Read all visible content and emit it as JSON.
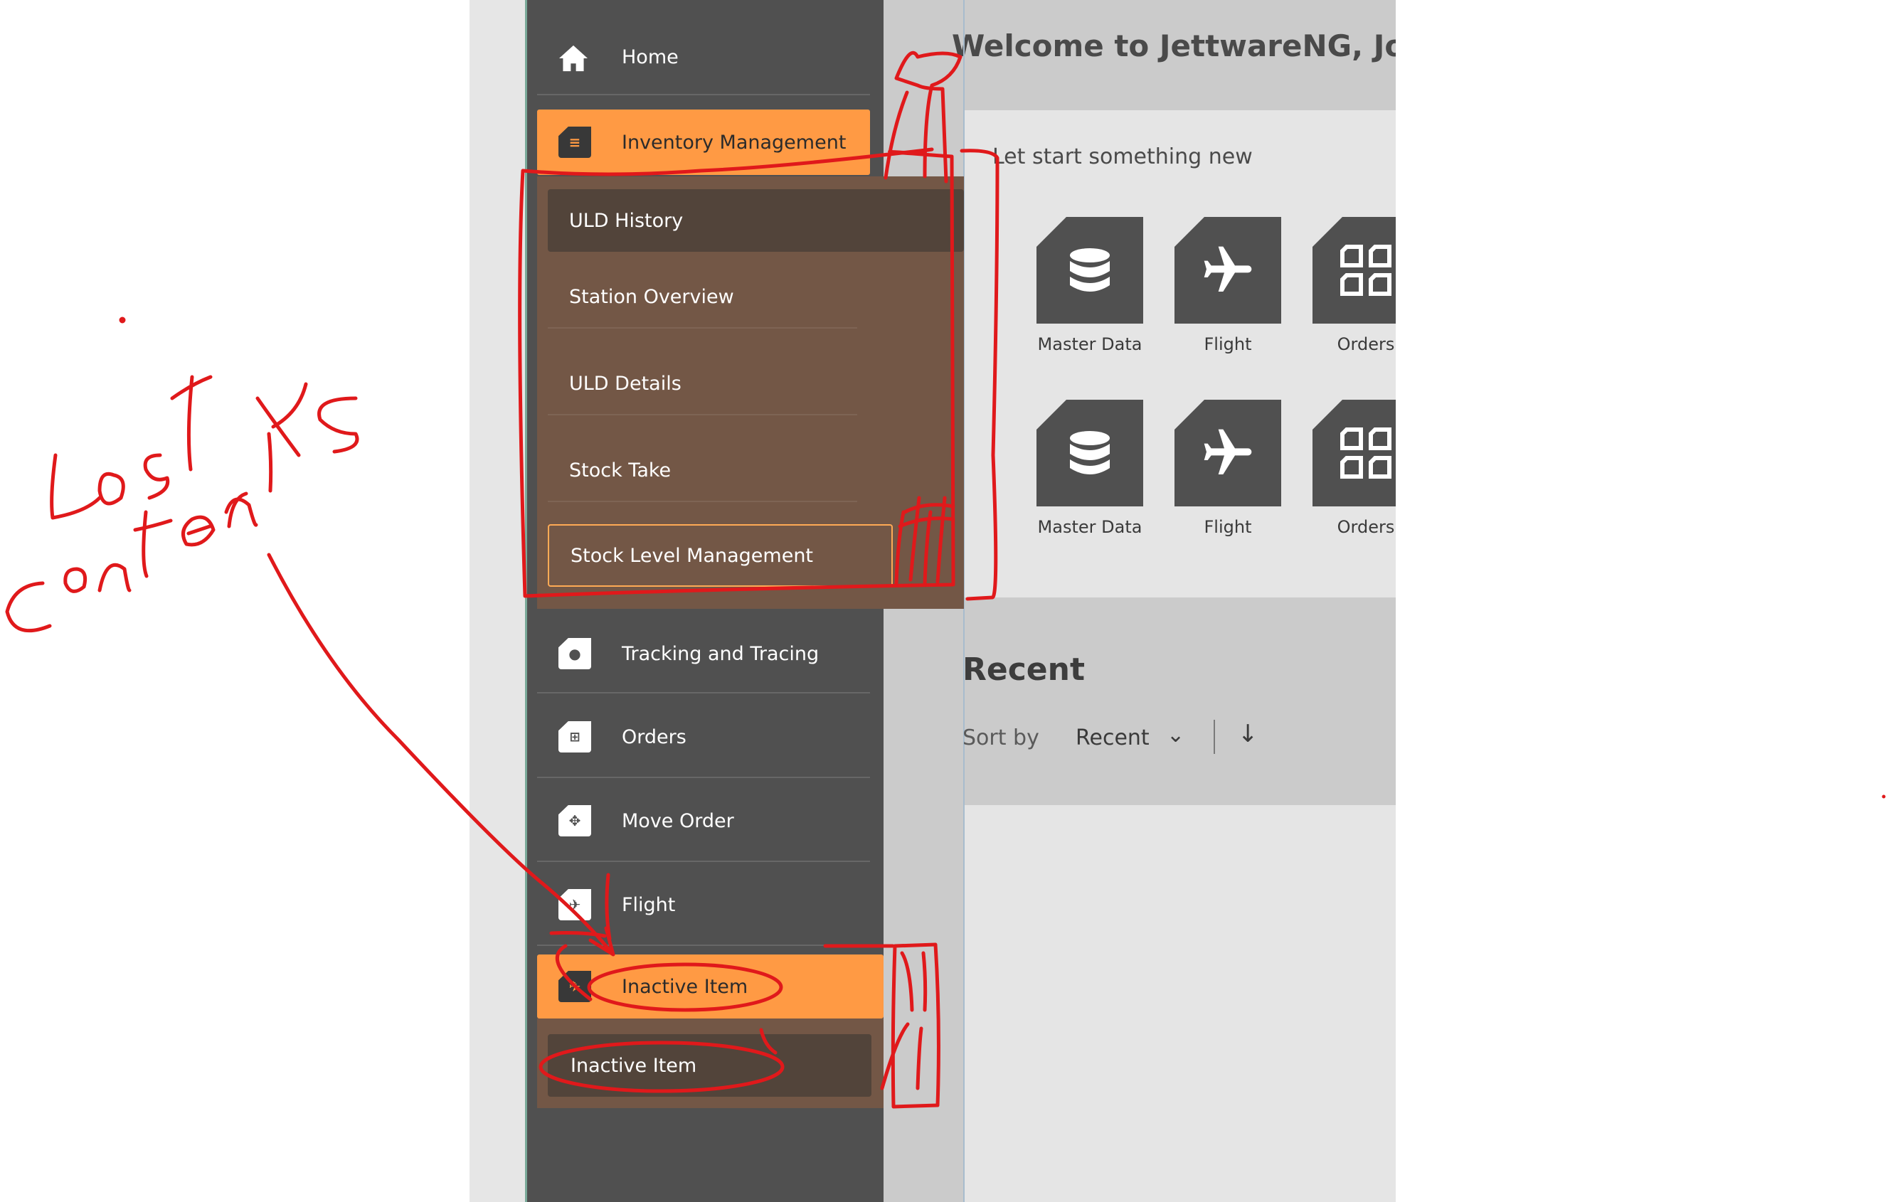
{
  "sidebar": {
    "items": [
      {
        "label": "Home",
        "icon": "home-icon"
      },
      {
        "label": "Inventory Management",
        "icon": "inventory-icon",
        "active": true
      },
      {
        "label": "Tracking and Tracing",
        "icon": "location-pin-icon"
      },
      {
        "label": "Orders",
        "icon": "orders-grid-icon"
      },
      {
        "label": "Move Order",
        "icon": "move-icon"
      },
      {
        "label": "Flight",
        "icon": "plane-icon"
      },
      {
        "label": "Inactive Item",
        "icon": "plane-icon",
        "active": true
      }
    ],
    "inventory_submenu": [
      {
        "label": "ULD History",
        "state": "selected"
      },
      {
        "label": "Station Overview"
      },
      {
        "label": "ULD Details"
      },
      {
        "label": "Stock Take"
      },
      {
        "label": "Stock Level Management",
        "state": "outlined"
      }
    ],
    "inactive_submenu": [
      {
        "label": "Inactive Item"
      }
    ]
  },
  "main": {
    "welcome": "Welcome to JettwareNG, Jo",
    "card_title": "Let start something new",
    "tiles": [
      {
        "label": "Master Data",
        "icon": "database-icon"
      },
      {
        "label": "Flight",
        "icon": "plane-icon"
      },
      {
        "label": "Orders",
        "icon": "orders-grid-icon"
      },
      {
        "label": "Master Data",
        "icon": "database-icon"
      },
      {
        "label": "Flight",
        "icon": "plane-icon"
      },
      {
        "label": "Orders",
        "icon": "orders-grid-icon"
      }
    ],
    "recent_title": "Recent",
    "sort_label": "Sort by",
    "sort_value": "Recent"
  },
  "annotation": {
    "text": "Lost contents",
    "color": "#e0191b"
  }
}
